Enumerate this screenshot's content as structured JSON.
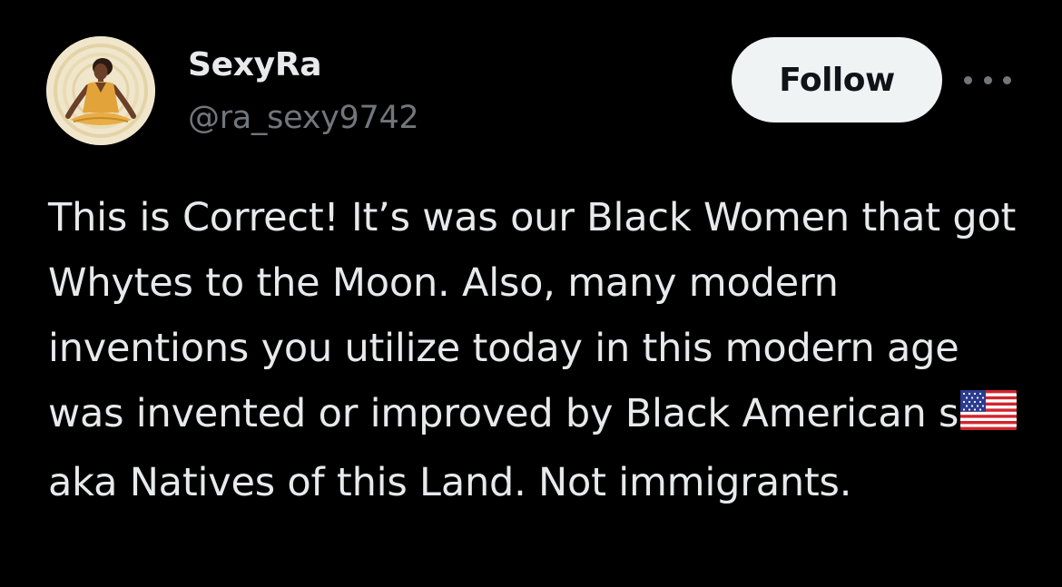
{
  "user": {
    "display_name": "SexyRa",
    "handle": "@ra_sexy9742"
  },
  "actions": {
    "follow_label": "Follow",
    "more_icon": "ellipsis-icon"
  },
  "tweet": {
    "text_before_flag": "This is Correct! It’s was our Black Women that got Whytes to the Moon. Also, many modern inventions you utilize today in this modern age was invented or improved by Black American s",
    "flag_emoji": "us-flag-icon",
    "text_after_flag": "aka Natives of this Land. Not immigrants."
  },
  "colors": {
    "background": "#000000",
    "primary_text": "#e7e9ea",
    "secondary_text": "#71767b",
    "follow_button_bg": "#eff3f4",
    "follow_button_text": "#0f1419"
  }
}
